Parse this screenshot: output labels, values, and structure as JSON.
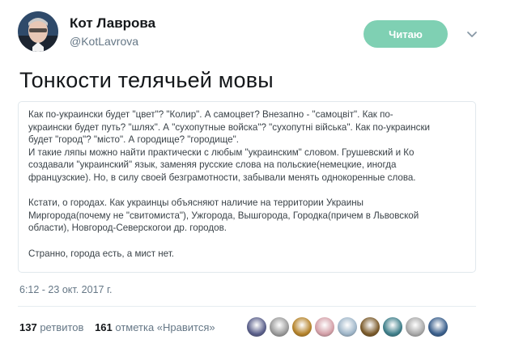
{
  "user": {
    "name": "Кот Лаврова",
    "handle": "@KotLavrova",
    "avatar_icon": "user-avatar"
  },
  "follow_button": {
    "label": "Читаю"
  },
  "tweet": {
    "text": "Тонкости телячьей мовы"
  },
  "card": {
    "paragraphs": [
      "Как по-украински будет \"цвет\"? \"Колир\". А самоцвет? Внезапно - \"самоцвiт\". Как по-\nукраински будет путь? \"шлях\". А \"сухопутные войска\"? \"сухопутнi вiйська\". Как по-украински\nбудет \"город\"? \"мiсто\". А городище? \"городище\".\nИ такие ляпы можно найти практически с любым \"украинским\" словом. Грушевский и Ко\nсоздавали \"украинский\" язык, заменяя русские слова на польские(немецкие, иногда\nфранцузские). Но, в силу своей безграмотности, забывали менять однокоренные слова.",
      "Кстати, о городах. Как украинцы объясняют наличие на территории Украины\nМиргорода(почему не \"свитомиста\"), Ужгорода, Вышгорода, Городка(причем в Львовской\nобласти), Новгород-Северскогои др. городов.",
      "Странно, города есть, а мист нет."
    ]
  },
  "timestamp": "6:12 - 23 окт. 2017 г.",
  "stats": {
    "retweets_count": "137",
    "retweets_label": "ретвитов",
    "likes_count": "161",
    "likes_label": "отметка «Нравится»"
  },
  "likers": [
    {
      "icon": "liker-avatar-1",
      "color": "#5a5f8a"
    },
    {
      "icon": "liker-avatar-2",
      "color": "#9a9a9a"
    },
    {
      "icon": "liker-avatar-3",
      "color": "#b5832a"
    },
    {
      "icon": "liker-avatar-4",
      "color": "#d4a0a8"
    },
    {
      "icon": "liker-avatar-5",
      "color": "#9fb6c9"
    },
    {
      "icon": "liker-avatar-6",
      "color": "#7a5a2a"
    },
    {
      "icon": "liker-avatar-7",
      "color": "#3f7f8a"
    },
    {
      "icon": "liker-avatar-8",
      "color": "#a9a9a9"
    },
    {
      "icon": "liker-avatar-9",
      "color": "#3a5f8c"
    }
  ],
  "colors": {
    "follow_bg": "#7fd0b3",
    "secondary_text": "#657786"
  }
}
